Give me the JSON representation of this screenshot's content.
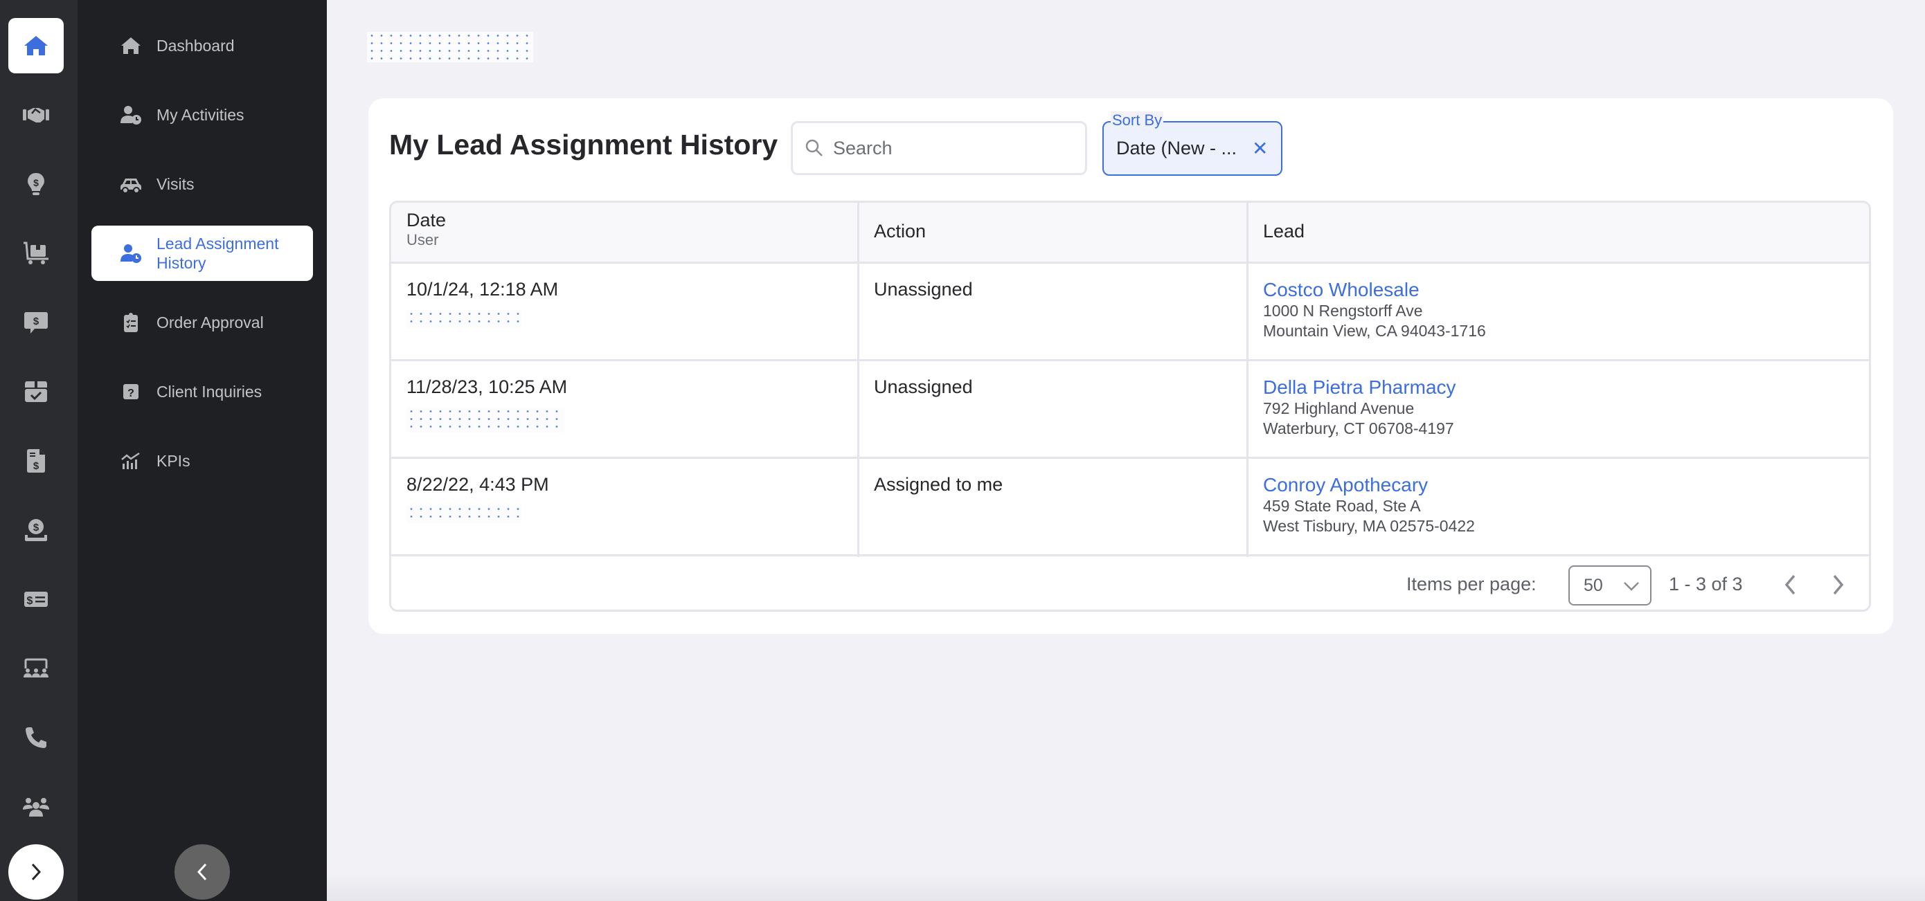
{
  "colors": {
    "accent": "#3d6ede",
    "rail_bg": "#2b2c2f",
    "nav_bg": "#1f2023",
    "page_bg": "#f2f1f6",
    "icon_gray": "#b4b5b7"
  },
  "rail": {
    "items": [
      {
        "icon": "home-icon",
        "active": true
      },
      {
        "icon": "handshake-icon"
      },
      {
        "icon": "lightbulb-dollar-icon"
      },
      {
        "icon": "dolly-box-icon"
      },
      {
        "icon": "comment-dollar-icon"
      },
      {
        "icon": "box-check-icon"
      },
      {
        "icon": "file-invoice-dollar-icon"
      },
      {
        "icon": "hand-holding-dollar-icon"
      },
      {
        "icon": "money-check-icon"
      },
      {
        "icon": "chalkboard-users-icon"
      },
      {
        "icon": "phone-icon"
      },
      {
        "icon": "users-icon"
      }
    ],
    "expand_icon": "chevron-right-icon"
  },
  "nav": {
    "items": [
      {
        "label": "Dashboard",
        "icon": "home-icon"
      },
      {
        "label": "My Activities",
        "icon": "user-clock-icon"
      },
      {
        "label": "Visits",
        "icon": "car-icon"
      },
      {
        "label": "Lead Assignment History",
        "icon": "user-clock-icon",
        "active": true
      },
      {
        "label": "Order Approval",
        "icon": "clipboard-list-icon"
      },
      {
        "label": "Client Inquiries",
        "icon": "question-square-icon"
      },
      {
        "label": "KPIs",
        "icon": "chart-line-icon"
      }
    ],
    "collapse_icon": "chevron-left-icon"
  },
  "page": {
    "title": "My Lead Assignment History",
    "search": {
      "placeholder": "Search",
      "value": ""
    },
    "sort": {
      "legend": "Sort By",
      "value": "Date (New - ...",
      "clear_icon": "close-icon"
    }
  },
  "table": {
    "headers": {
      "date": "Date",
      "user": "User",
      "action": "Action",
      "lead": "Lead"
    },
    "rows": [
      {
        "date": "10/1/24, 12:18 AM",
        "user": "[redacted]",
        "action": "Unassigned",
        "lead_name": "Costco Wholesale",
        "address_line1": "1000 N Rengstorff Ave",
        "address_line2": "Mountain View, CA 94043-1716"
      },
      {
        "date": "11/28/23, 10:25 AM",
        "user": "[redacted]",
        "action": "Unassigned",
        "lead_name": "Della Pietra Pharmacy",
        "address_line1": "792 Highland Avenue",
        "address_line2": "Waterbury, CT 06708-4197"
      },
      {
        "date": "8/22/22, 4:43 PM",
        "user": "[redacted]",
        "action": "Assigned to me",
        "lead_name": "Conroy Apothecary",
        "address_line1": "459 State Road, Ste A",
        "address_line2": "West Tisbury, MA 02575-0422"
      }
    ],
    "pagination": {
      "items_per_page_label": "Items per page:",
      "items_per_page": "50",
      "range": "1 - 3 of 3",
      "prev_icon": "chevron-left-icon",
      "next_icon": "chevron-right-icon"
    }
  }
}
